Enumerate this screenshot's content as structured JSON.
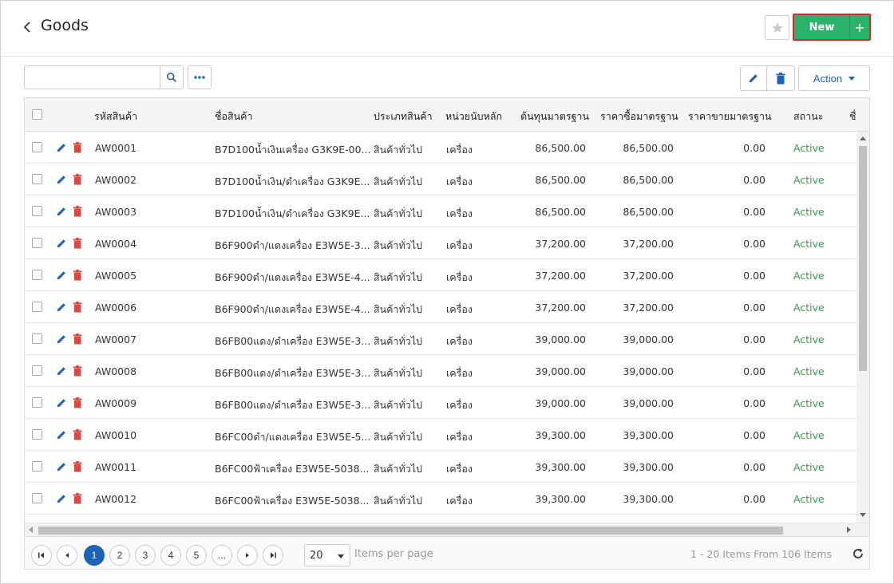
{
  "header": {
    "title": "Goods",
    "new_label": "New",
    "plus_label": "+"
  },
  "toolbar": {
    "search_placeholder": "",
    "action_label": "Action"
  },
  "columns": [
    "รหัสสินค้า",
    "ชื่อสินค้า",
    "ประเภทสินค้า",
    "หน่วยนับหลัก",
    "ต้นทุนมาตรฐาน",
    "ราคาซื้อมาตรฐาน",
    "ราคาขายมาตรฐาน",
    "สถานะ",
    "ชื่"
  ],
  "rows": [
    {
      "code": "AW0001",
      "name": "B7D100น้ำเงินเครื่อง G3K9E-00...",
      "type": "สินค้าทั่วไป",
      "unit": "เครื่อง",
      "cost": "86,500.00",
      "buy": "86,500.00",
      "sell": "0.00",
      "status": "Active"
    },
    {
      "code": "AW0002",
      "name": "B7D100น้ำเงิน/ดำเครื่อง G3K9E...",
      "type": "สินค้าทั่วไป",
      "unit": "เครื่อง",
      "cost": "86,500.00",
      "buy": "86,500.00",
      "sell": "0.00",
      "status": "Active"
    },
    {
      "code": "AW0003",
      "name": "B7D100น้ำเงิน/ดำเครื่อง G3K9E...",
      "type": "สินค้าทั่วไป",
      "unit": "เครื่อง",
      "cost": "86,500.00",
      "buy": "86,500.00",
      "sell": "0.00",
      "status": "Active"
    },
    {
      "code": "AW0004",
      "name": "B6F900ดำ/แดงเครื่อง E3W5E-3...",
      "type": "สินค้าทั่วไป",
      "unit": "เครื่อง",
      "cost": "37,200.00",
      "buy": "37,200.00",
      "sell": "0.00",
      "status": "Active"
    },
    {
      "code": "AW0005",
      "name": "B6F900ดำ/แดงเครื่อง E3W5E-4...",
      "type": "สินค้าทั่วไป",
      "unit": "เครื่อง",
      "cost": "37,200.00",
      "buy": "37,200.00",
      "sell": "0.00",
      "status": "Active"
    },
    {
      "code": "AW0006",
      "name": "B6F900ดำ/แดงเครื่อง E3W5E-4...",
      "type": "สินค้าทั่วไป",
      "unit": "เครื่อง",
      "cost": "37,200.00",
      "buy": "37,200.00",
      "sell": "0.00",
      "status": "Active"
    },
    {
      "code": "AW0007",
      "name": "B6FB00แดง/ดำเครื่อง E3W5E-3...",
      "type": "สินค้าทั่วไป",
      "unit": "เครื่อง",
      "cost": "39,000.00",
      "buy": "39,000.00",
      "sell": "0.00",
      "status": "Active"
    },
    {
      "code": "AW0008",
      "name": "B6FB00แดง/ดำเครื่อง E3W5E-3...",
      "type": "สินค้าทั่วไป",
      "unit": "เครื่อง",
      "cost": "39,000.00",
      "buy": "39,000.00",
      "sell": "0.00",
      "status": "Active"
    },
    {
      "code": "AW0009",
      "name": "B6FB00แดง/ดำเครื่อง E3W5E-3...",
      "type": "สินค้าทั่วไป",
      "unit": "เครื่อง",
      "cost": "39,000.00",
      "buy": "39,000.00",
      "sell": "0.00",
      "status": "Active"
    },
    {
      "code": "AW0010",
      "name": "B6FC00ดำ/แดงเครื่อง E3W5E-5...",
      "type": "สินค้าทั่วไป",
      "unit": "เครื่อง",
      "cost": "39,300.00",
      "buy": "39,300.00",
      "sell": "0.00",
      "status": "Active"
    },
    {
      "code": "AW0011",
      "name": "B6FC00ฟ้าเครื่อง E3W5E-5038...",
      "type": "สินค้าทั่วไป",
      "unit": "เครื่อง",
      "cost": "39,300.00",
      "buy": "39,300.00",
      "sell": "0.00",
      "status": "Active"
    },
    {
      "code": "AW0012",
      "name": "B6FC00ฟ้าเครื่อง E3W5E-5038...",
      "type": "สินค้าทั่วไป",
      "unit": "เครื่อง",
      "cost": "39,300.00",
      "buy": "39,300.00",
      "sell": "0.00",
      "status": "Active"
    }
  ],
  "pager": {
    "pages": [
      "1",
      "2",
      "3",
      "4",
      "5",
      "..."
    ],
    "current": "1",
    "per_page": "20",
    "per_page_label": "Items per page",
    "summary": "1 - 20 Items From 106 Items"
  },
  "colors": {
    "accent": "#1a63b8",
    "new_button": "#2bb36b",
    "active_status": "#2d9e3f",
    "delete_icon": "#e0453a"
  },
  "icons": [
    "chevron-left-icon",
    "star-icon",
    "search-icon",
    "more-icon",
    "pencil-icon",
    "trash-icon",
    "caret-down-icon",
    "first-page-icon",
    "prev-page-icon",
    "next-page-icon",
    "last-page-icon",
    "refresh-icon"
  ]
}
